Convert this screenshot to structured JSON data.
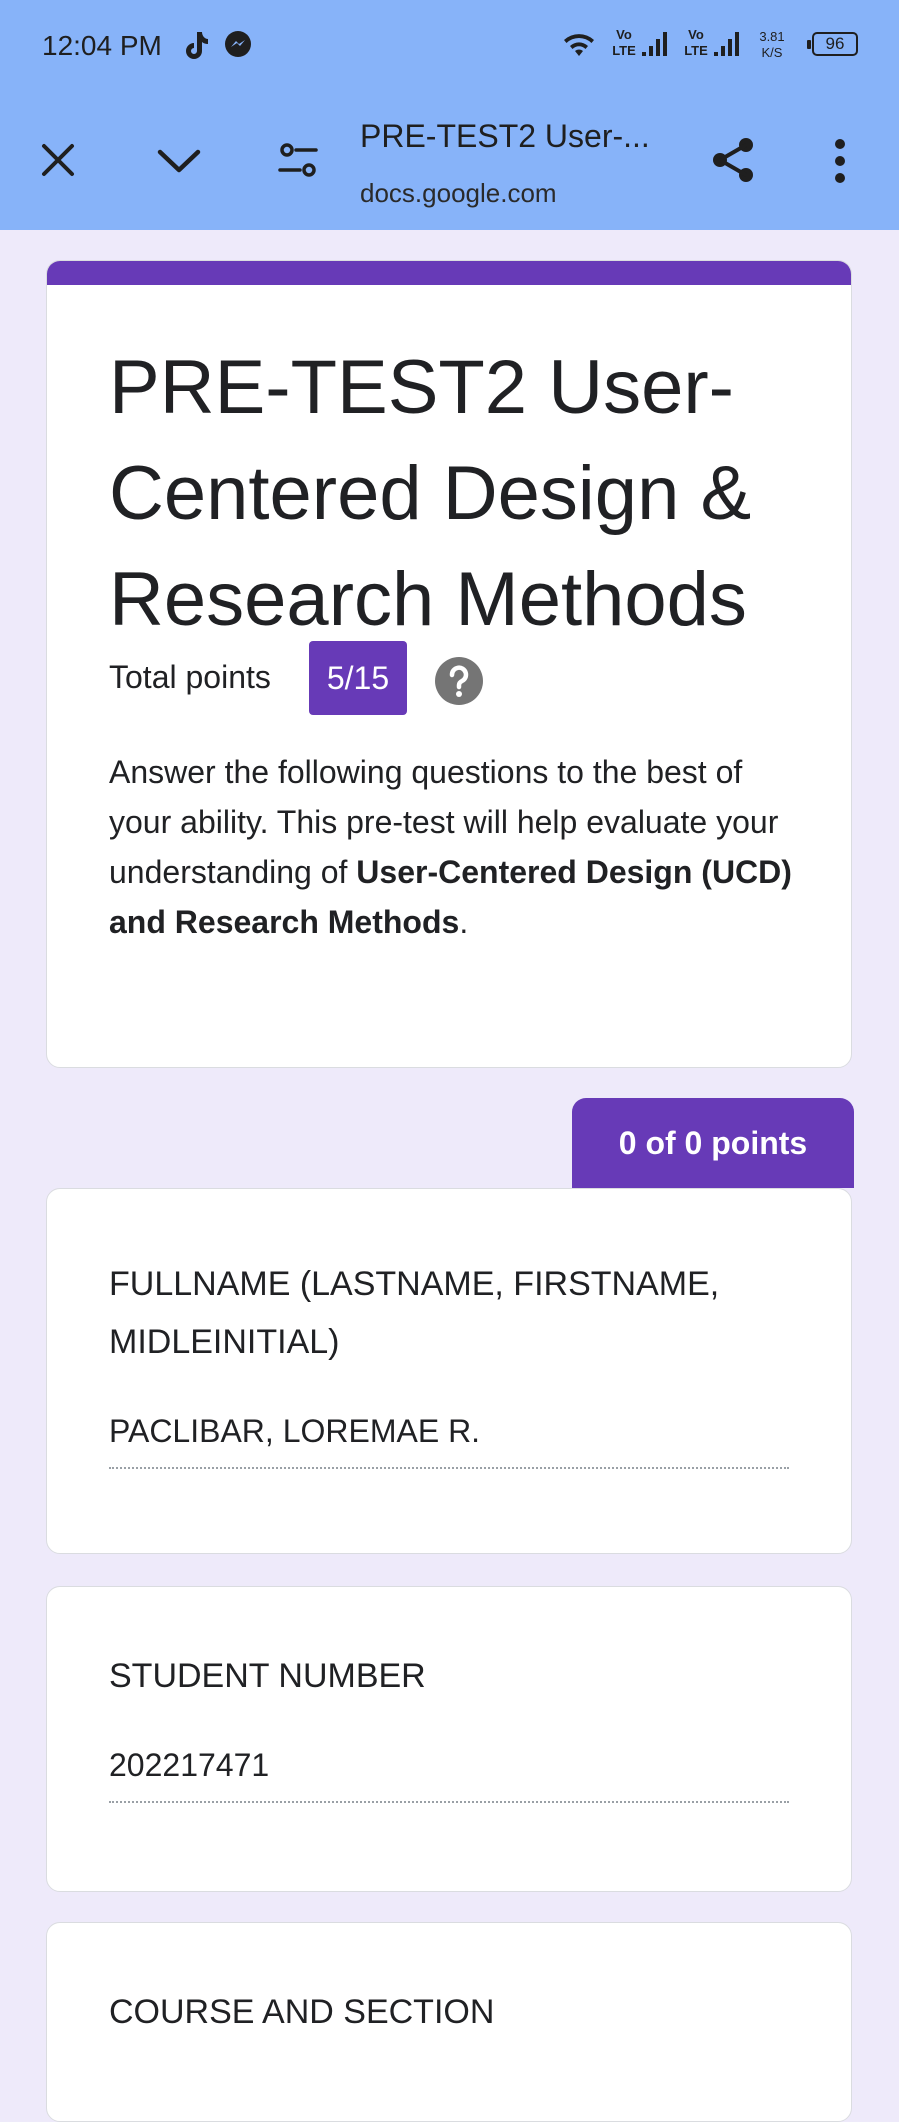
{
  "status_bar": {
    "time": "12:04 PM",
    "sim1_tag_top": "Vo",
    "sim1_tag_bottom": "LTE",
    "sim2_tag_top": "Vo",
    "sim2_tag_bottom": "LTE",
    "speed_value": "3.81",
    "speed_unit": "K/S",
    "battery": "96",
    "notification_icons": [
      "tiktok-icon",
      "messenger-icon"
    ]
  },
  "browser_toolbar": {
    "page_title": "PRE-TEST2 User-...",
    "domain": "docs.google.com",
    "icons": [
      "close-icon",
      "chevron-down-icon",
      "page-controls-icon",
      "share-icon",
      "more-vert-icon"
    ]
  },
  "form": {
    "accent_color": "#673ab7",
    "title": "PRE-TEST2 User-Centered Design & Research Methods",
    "total_points_label": "Total points",
    "total_points_value": "5/15",
    "description_lead": " Answer the following questions to the best of your ability. This pre-test will help evaluate your understanding of ",
    "description_bold": "User-Centered Design (UCD) and Research Methods",
    "description_tail": ".",
    "section_points": "0 of 0 points",
    "questions": [
      {
        "title": "FULLNAME (LASTNAME, FIRSTNAME, MIDLEINITIAL)",
        "answer": "PACLIBAR, LOREMAE R."
      },
      {
        "title": "STUDENT NUMBER",
        "answer": "202217471"
      },
      {
        "title": "COURSE AND SECTION",
        "answer": ""
      }
    ]
  }
}
